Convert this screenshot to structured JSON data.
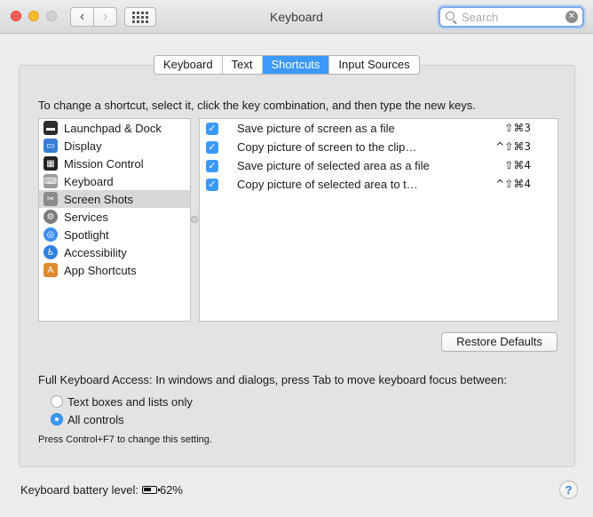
{
  "window": {
    "title": "Keyboard"
  },
  "search": {
    "placeholder": "Search",
    "value": ""
  },
  "tabs": [
    {
      "label": "Keyboard",
      "active": false
    },
    {
      "label": "Text",
      "active": false
    },
    {
      "label": "Shortcuts",
      "active": true
    },
    {
      "label": "Input Sources",
      "active": false
    }
  ],
  "instructions": "To change a shortcut, select it, click the key combination, and then type the new keys.",
  "categories": [
    {
      "label": "Launchpad & Dock",
      "icon": "launchpad-dock-icon",
      "color": "#2d2d2d"
    },
    {
      "label": "Display",
      "icon": "display-icon",
      "color": "#3a7fd5"
    },
    {
      "label": "Mission Control",
      "icon": "mission-control-icon",
      "color": "#222222"
    },
    {
      "label": "Keyboard",
      "icon": "keyboard-icon",
      "color": "#9a9a9a"
    },
    {
      "label": "Screen Shots",
      "icon": "screenshot-icon",
      "color": "#8a8a8a",
      "selected": true
    },
    {
      "label": "Services",
      "icon": "gear-icon",
      "color": "#7c7c7c"
    },
    {
      "label": "Spotlight",
      "icon": "spotlight-icon",
      "color": "#3b8ff0"
    },
    {
      "label": "Accessibility",
      "icon": "accessibility-icon",
      "color": "#2f7fe0"
    },
    {
      "label": "App Shortcuts",
      "icon": "app-shortcuts-icon",
      "color": "#e08a2f"
    }
  ],
  "shortcuts": [
    {
      "checked": true,
      "label": "Save picture of screen as a file",
      "keys": "⇧⌘3"
    },
    {
      "checked": true,
      "label": "Copy picture of screen to the clip…",
      "keys": "^⇧⌘3"
    },
    {
      "checked": true,
      "label": "Save picture of selected area as a file",
      "keys": "⇧⌘4"
    },
    {
      "checked": true,
      "label": "Copy picture of selected area to t…",
      "keys": "^⇧⌘4"
    }
  ],
  "restore_button": "Restore Defaults",
  "full_keyboard_access": {
    "label": "Full Keyboard Access: In windows and dialogs, press Tab to move keyboard focus between:",
    "options": [
      {
        "label": "Text boxes and lists only",
        "selected": false
      },
      {
        "label": "All controls",
        "selected": true
      }
    ],
    "hint": "Press Control+F7 to change this setting."
  },
  "battery": {
    "label": "Keyboard battery level:",
    "value": "62%",
    "level": 0.62
  },
  "accent_color": "#3b99fc"
}
